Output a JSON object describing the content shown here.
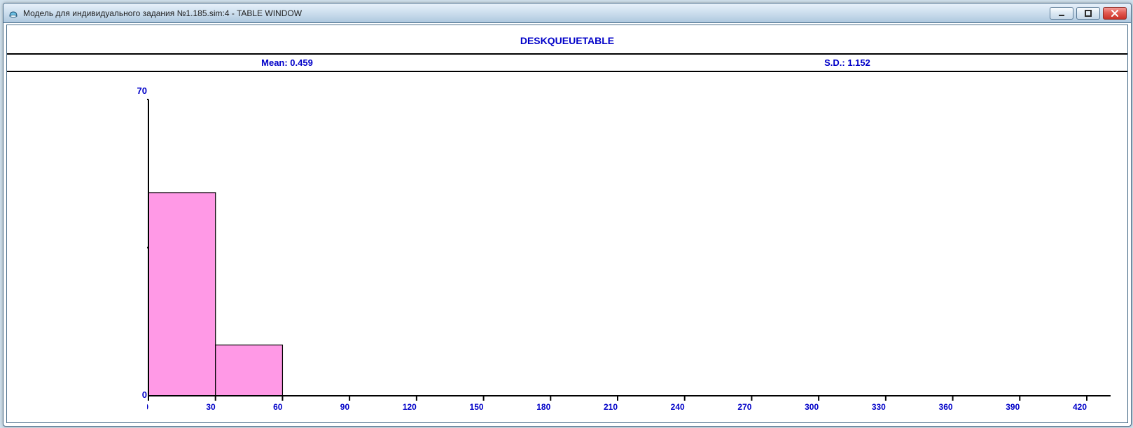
{
  "window": {
    "title": "Модель для индивидуального задания №1.185.sim:4  -  TABLE WINDOW"
  },
  "chart": {
    "title": "DESKQUEUETABLE",
    "mean_label": "Mean: 0.459",
    "sd_label": "S.D.: 1.152",
    "y_max_label": "70",
    "y_min_label": "0"
  },
  "chart_data": {
    "type": "bar",
    "title": "DESKQUEUETABLE",
    "xlabel": "",
    "ylabel": "",
    "ylim": [
      0,
      70
    ],
    "xlim": [
      0,
      420
    ],
    "x_ticks": [
      0,
      30,
      60,
      90,
      120,
      150,
      180,
      210,
      240,
      270,
      300,
      330,
      360,
      390,
      420
    ],
    "categories": [
      "0-30",
      "30-60"
    ],
    "values": [
      48,
      12
    ],
    "mean": 0.459,
    "sd": 1.152
  }
}
